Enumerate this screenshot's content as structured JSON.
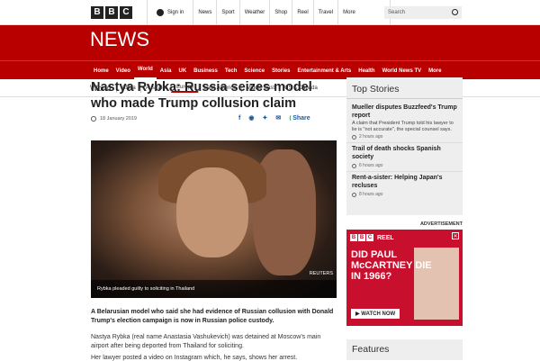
{
  "header": {
    "logo": [
      "B",
      "B",
      "C"
    ],
    "signin": "Sign in",
    "nav": [
      "News",
      "Sport",
      "Weather",
      "Shop",
      "Reel",
      "Travel",
      "More"
    ],
    "search_placeholder": "Search"
  },
  "brand": {
    "news": "NEWS"
  },
  "mainnav": [
    "Home",
    "Video",
    "World",
    "Asia",
    "UK",
    "Business",
    "Tech",
    "Science",
    "Stories",
    "Entertainment & Arts",
    "Health",
    "World News TV",
    "More"
  ],
  "subnav": {
    "section": "World",
    "items": [
      "Africa",
      "Australia",
      "Europe",
      "Latin America",
      "Middle East",
      "US & Canada"
    ]
  },
  "article": {
    "title": "Nastya Rybka: Russia seizes model who made Trump collusion claim",
    "date": "18 January 2019",
    "share_label": "Share",
    "photo_credit": "REUTERS",
    "photo_caption": "Rybka pleaded guilty to soliciting in Thailand",
    "lead": "A Belarusian model who said she had evidence of Russian collusion with Donald Trump's election campaign is now in Russian police custody.",
    "para1": "Nastya Rybka (real name Anastasia Vashukevich) was detained at Moscow's main airport after being deported from Thailand for soliciting.",
    "para2": "Her lawyer posted a video on Instagram which, he says, shows her arrest."
  },
  "top_stories": {
    "heading": "Top Stories",
    "items": [
      {
        "title": "Mueller disputes Buzzfeed's Trump report",
        "desc": "A claim that President Trump told his lawyer to lie is \"not accurate\", the special counsel says.",
        "time": "2 hours ago"
      },
      {
        "title": "Trail of death shocks Spanish society",
        "time": "6 hours ago"
      },
      {
        "title": "Rent-a-sister: Helping Japan's recluses",
        "time": "8 hours ago"
      }
    ]
  },
  "ad": {
    "label": "ADVERTISEMENT",
    "reel_logo": [
      "B",
      "B",
      "C"
    ],
    "reel": "REEL",
    "headline": "DID PAUL McCARTNEY DIE IN 1966?",
    "cta": "▶ WATCH NOW",
    "close": "✕"
  },
  "features": {
    "heading": "Features"
  }
}
